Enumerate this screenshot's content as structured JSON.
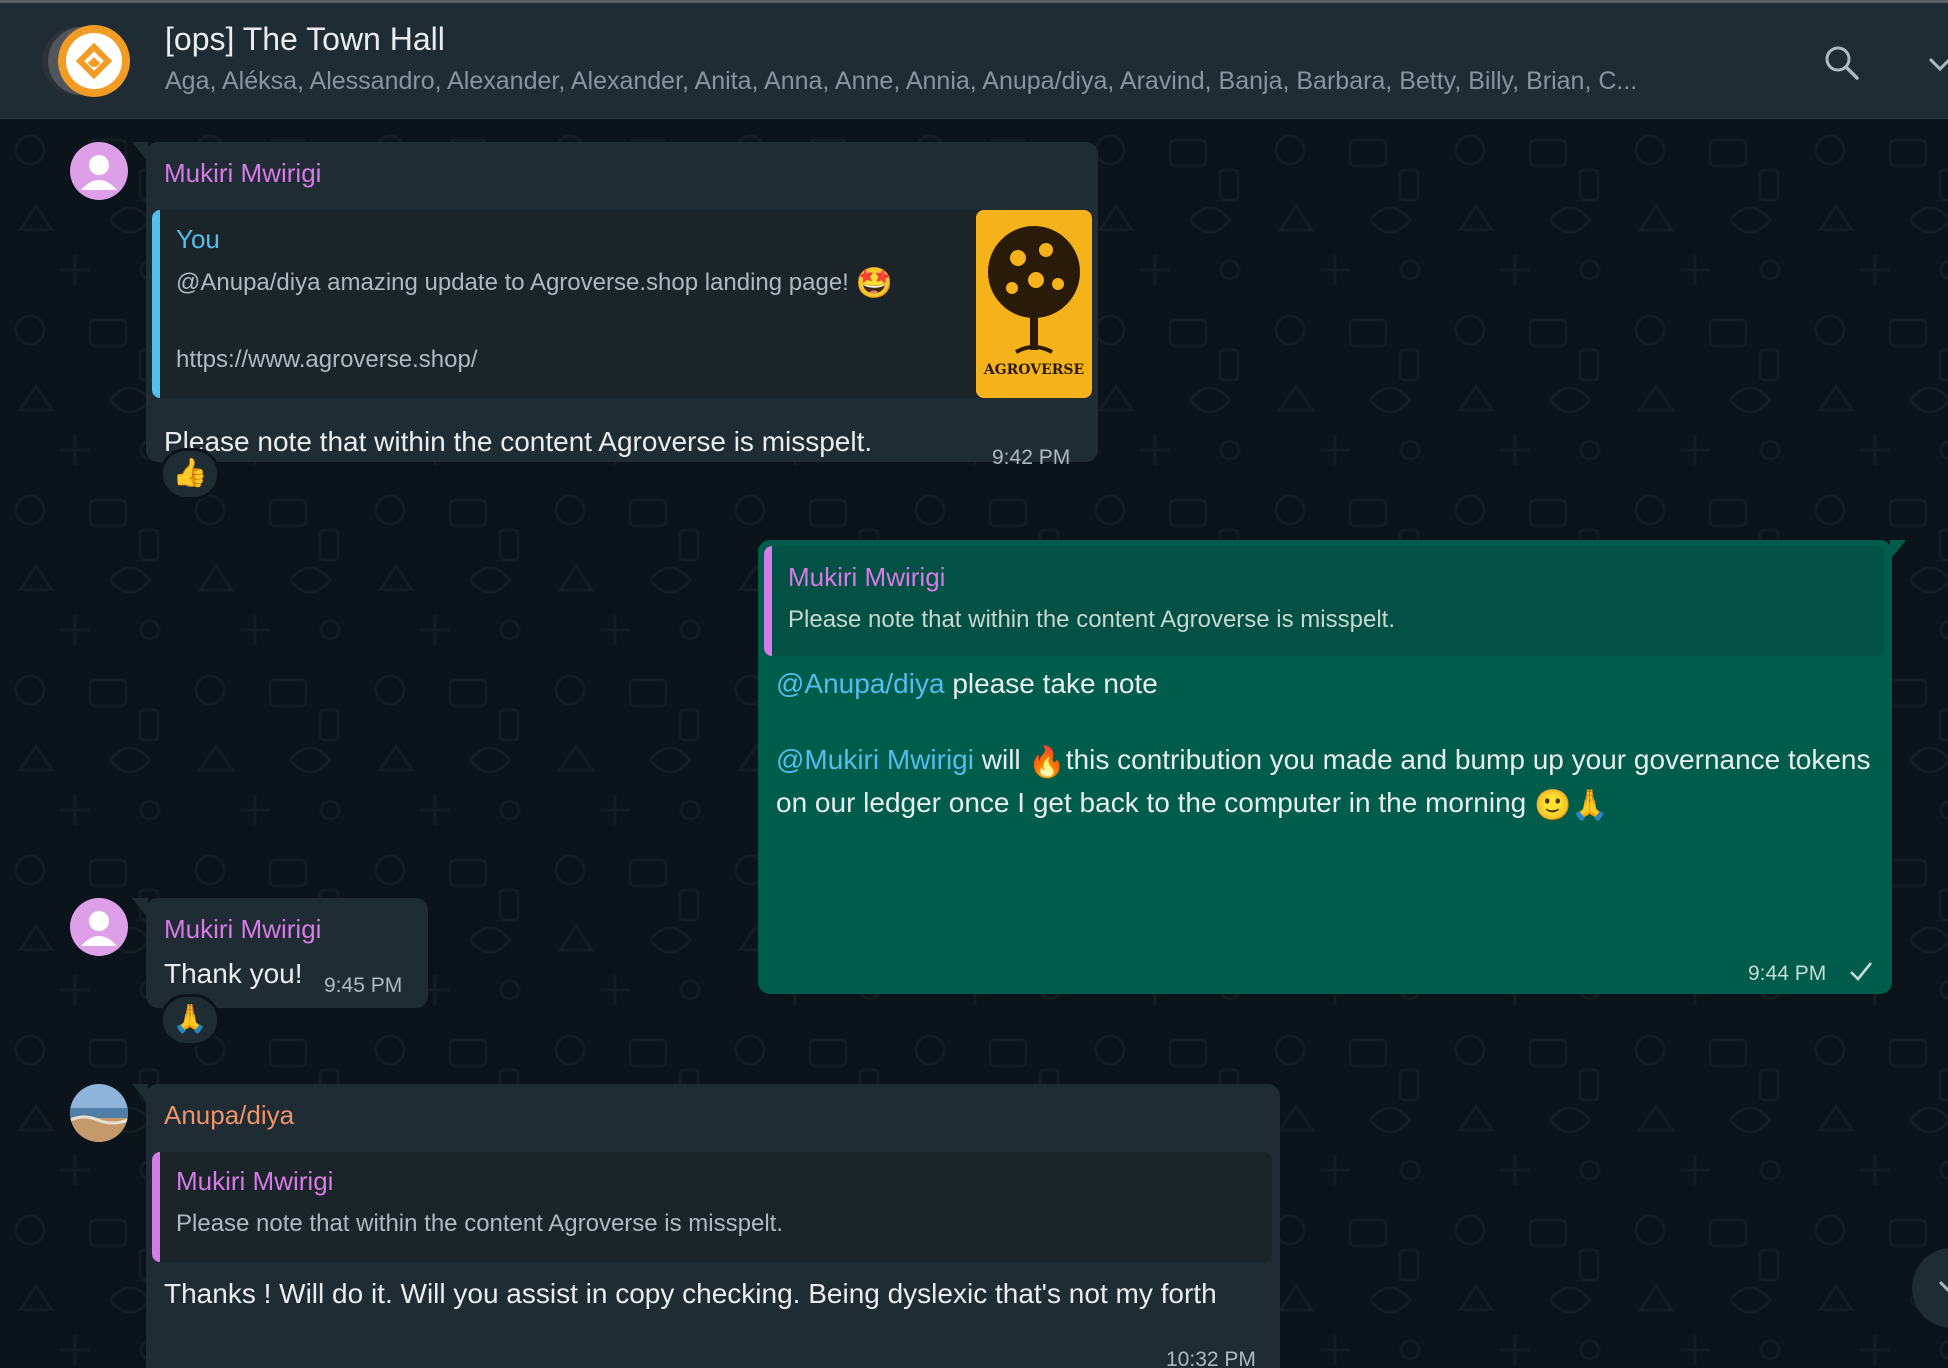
{
  "header": {
    "title": "[ops] The Town Hall",
    "participants": "Aga, Aléksa, Alessandro, Alexander, Alexander, Anita, Anna, Anne, Annia, Anupa/diya, Aravind, Banja, Barbara, Betty, Billy, Brian, C...",
    "search_icon": "search-icon",
    "menu_icon": "chevron-down-icon"
  },
  "colors": {
    "incoming_bubble": "#202c33",
    "outgoing_bubble": "#005c4b",
    "mention": "#53bdeb",
    "name_mukiri": "#d57ae6",
    "name_you": "#53bdeb",
    "name_anupa": "#f0926c"
  },
  "messages": [
    {
      "sender": "Mukiri Mwirigi",
      "quoted": {
        "name": "You",
        "text": "@Anupa/diya amazing update to Agroverse.shop landing page!",
        "emoji": "🤩",
        "link": "https://www.agroverse.shop/",
        "thumbnail_label": "AGROVERSE"
      },
      "text": "Please note that within the content Agroverse is misspelt.",
      "time": "9:42 PM",
      "reaction": "👍"
    },
    {
      "sender": "You",
      "quoted": {
        "name": "Mukiri Mwirigi",
        "text": "Please note that within the content Agroverse is misspelt."
      },
      "line1_mention": "@Anupa/diya",
      "line1_text": " please take note",
      "line2_mention": "@Mukiri Mwirigi",
      "line2_text_a": " will ",
      "line2_emoji": "🔥",
      "line2_text_b": "this contribution you made and bump up your governance tokens on our ledger once I get back to the computer in the morning ",
      "line2_end_emoji": "🙂🙏",
      "time": "9:44 PM",
      "status_icon": "check-icon"
    },
    {
      "sender": "Mukiri Mwirigi",
      "text": "Thank you!",
      "time": "9:45 PM",
      "reaction": "🙏"
    },
    {
      "sender": "Anupa/diya",
      "quoted": {
        "name": "Mukiri Mwirigi",
        "text": "Please note that within the content Agroverse is misspelt."
      },
      "text": "Thanks ! Will do it. Will you assist in copy checking. Being dyslexic that's not my forth",
      "time": "10:32 PM"
    }
  ]
}
